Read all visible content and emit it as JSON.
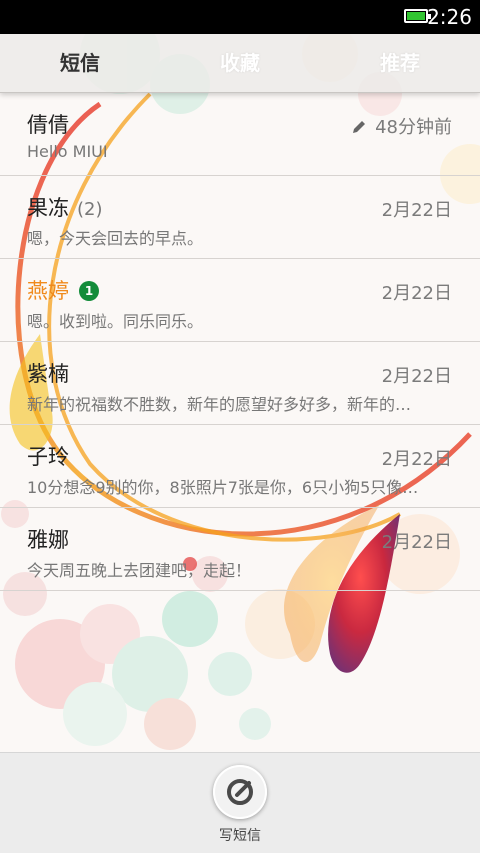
{
  "status_bar": {
    "time": "2:26",
    "battery_icon": "battery-icon"
  },
  "tabs": [
    {
      "label": "短信",
      "active": true
    },
    {
      "label": "收藏",
      "active": false
    },
    {
      "label": "推荐",
      "active": false
    }
  ],
  "conversations": [
    {
      "name": "倩倩",
      "count": "",
      "badge": "",
      "time": "48分钟前",
      "draft": true,
      "preview": "Hello MIUI",
      "highlight": false
    },
    {
      "name": "果冻",
      "count": "(2)",
      "badge": "",
      "time": "2月22日",
      "draft": false,
      "preview": "嗯，今天会回去的早点。",
      "highlight": false
    },
    {
      "name": "燕婷",
      "count": "",
      "badge": "1",
      "time": "2月22日",
      "draft": false,
      "preview": "嗯。收到啦。同乐同乐。",
      "highlight": true
    },
    {
      "name": "紫楠",
      "count": "",
      "badge": "",
      "time": "2月22日",
      "draft": false,
      "preview": "新年的祝福数不胜数，新年的愿望好多好多，新年的…",
      "highlight": false
    },
    {
      "name": "子玲",
      "count": "",
      "badge": "",
      "time": "2月22日",
      "draft": false,
      "preview": "10分想念9别的你，8张照片7张是你，6只小狗5只像…",
      "highlight": false
    },
    {
      "name": "雅娜",
      "count": "",
      "badge": "",
      "time": "2月22日",
      "draft": false,
      "preview": "今天周五晚上去团建吧，走起！",
      "highlight": false
    }
  ],
  "bottom": {
    "compose_label": "写短信",
    "compose_icon": "compose-icon"
  },
  "colors": {
    "accent": "#f08a1c",
    "badge": "#138c3a",
    "battery": "#31c531"
  }
}
